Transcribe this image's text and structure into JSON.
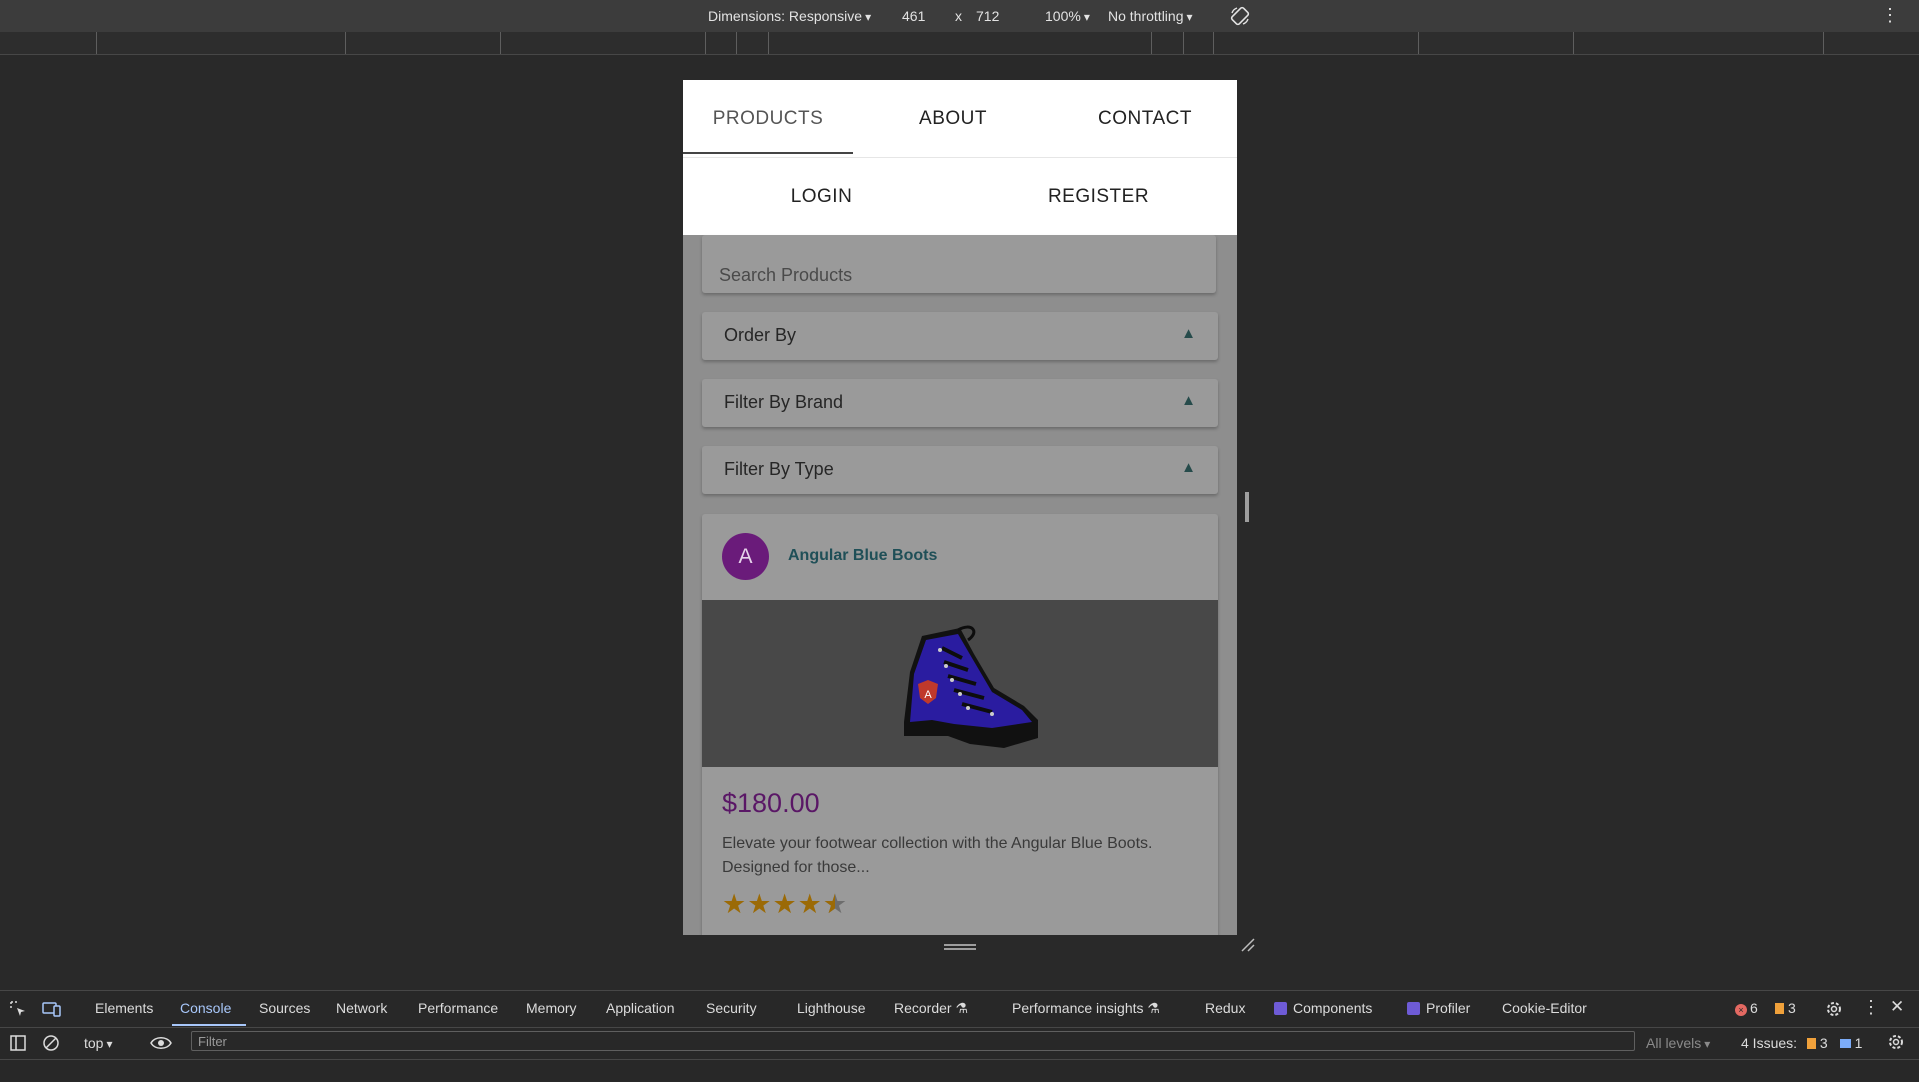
{
  "device_toolbar": {
    "dimensions_label": "Dimensions: Responsive",
    "width": "461",
    "times": "x",
    "height": "712",
    "zoom": "100%",
    "throttling": "No throttling"
  },
  "nav": {
    "products": "PRODUCTS",
    "about": "ABOUT",
    "contact": "CONTACT",
    "login": "LOGIN",
    "register": "REGISTER"
  },
  "search": {
    "placeholder": "Search Products"
  },
  "filters": {
    "order_by": "Order By",
    "filter_brand": "Filter By Brand",
    "filter_type": "Filter By Type",
    "arrow": "▲"
  },
  "product": {
    "avatar_letter": "A",
    "title": "Angular Blue Boots",
    "price": "$180.00",
    "description": "Elevate your footwear collection with the Angular Blue Boots. Designed for those...",
    "rating": 4.5,
    "star": "★"
  },
  "devtools": {
    "tabs": {
      "elements": "Elements",
      "console": "Console",
      "sources": "Sources",
      "network": "Network",
      "performance": "Performance",
      "memory": "Memory",
      "application": "Application",
      "security": "Security",
      "lighthouse": "Lighthouse",
      "recorder": "Recorder",
      "performance_insights": "Performance insights",
      "redux": "Redux",
      "components": "Components",
      "profiler": "Profiler",
      "cookie_editor": "Cookie-Editor"
    },
    "error_count": "6",
    "warning_count": "3",
    "context": "top",
    "filter_placeholder": "Filter",
    "levels": "All levels",
    "issues_label": "4 Issues:",
    "issues_warnings": "3",
    "issues_info": "1"
  },
  "colors": {
    "accent": "#a8c7fa",
    "price": "#5a1766",
    "avatar": "#6a1b7a",
    "star": "#9b6a06",
    "title": "#1f4f57"
  }
}
